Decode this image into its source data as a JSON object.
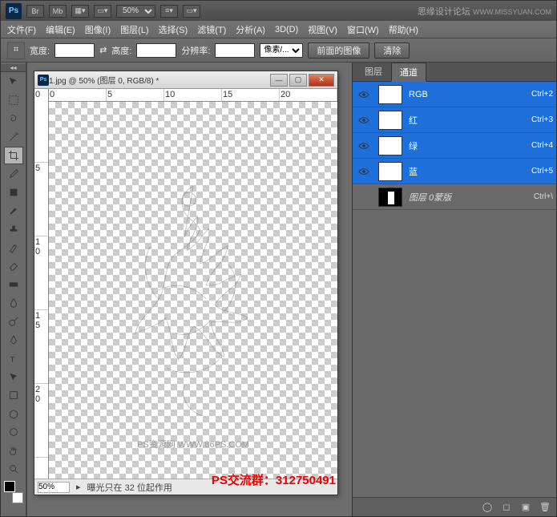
{
  "titlebar": {
    "zoom": "50%",
    "watermark": "思缘设计论坛",
    "watermark_url": "WWW.MISSYUAN.COM"
  },
  "menu": [
    "文件(F)",
    "编辑(E)",
    "图像(I)",
    "图层(L)",
    "选择(S)",
    "滤镜(T)",
    "分析(A)",
    "3D(D)",
    "视图(V)",
    "窗口(W)",
    "帮助(H)"
  ],
  "optbar": {
    "width": "宽度:",
    "height": "高度:",
    "res": "分辨率:",
    "unit": "像素/...",
    "btn_front": "前面的图像",
    "btn_clear": "清除"
  },
  "doc": {
    "title": "1.jpg @ 50% (图层 0, RGB/8) *",
    "zoom": "50%",
    "status": "曝光只在 32 位起作用",
    "canvas_wm": "PS资源网    WWW.86PS.COM"
  },
  "panels": {
    "tab_layers": "图层",
    "tab_channels": "通道",
    "channels": [
      {
        "name": "RGB",
        "shortcut": "Ctrl+2",
        "selected": true,
        "eye": true,
        "mask": false
      },
      {
        "name": "红",
        "shortcut": "Ctrl+3",
        "selected": true,
        "eye": true,
        "mask": false
      },
      {
        "name": "绿",
        "shortcut": "Ctrl+4",
        "selected": true,
        "eye": true,
        "mask": false
      },
      {
        "name": "蓝",
        "shortcut": "Ctrl+5",
        "selected": true,
        "eye": true,
        "mask": false
      },
      {
        "name": "图层 0蒙版",
        "shortcut": "Ctrl+\\",
        "selected": false,
        "eye": false,
        "mask": true
      }
    ]
  },
  "red_overlay": "PS交流群：312750491"
}
